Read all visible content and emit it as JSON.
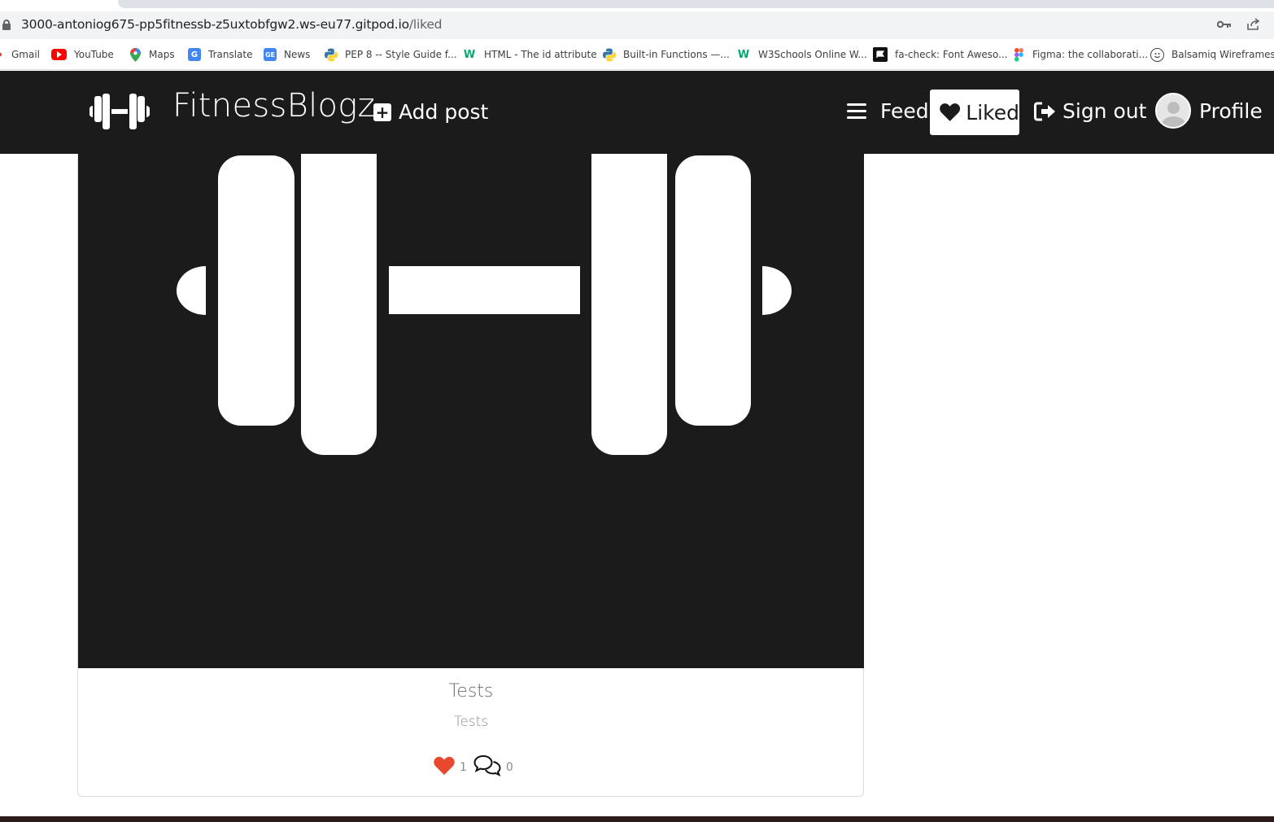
{
  "browser": {
    "url_host": "3000-antoniog675-pp5fitnessb-z5uxtobfgw2.ws-eu77.gitpod.io",
    "url_path": "/liked",
    "bookmarks": [
      {
        "label": "Gmail",
        "icon": "gmail-icon",
        "color": "#ea4335"
      },
      {
        "label": "YouTube",
        "icon": "youtube-icon",
        "color": "#ff0000"
      },
      {
        "label": "Maps",
        "icon": "maps-icon",
        "color": "#34a853"
      },
      {
        "label": "Translate",
        "icon": "translate-icon",
        "color": "#4285f4"
      },
      {
        "label": "News",
        "icon": "news-icon",
        "color": "#4285f4"
      },
      {
        "label": "PEP 8 -- Style Guide f...",
        "icon": "python-icon",
        "color": "#3776ab"
      },
      {
        "label": "HTML - The id attribute",
        "icon": "w3schools-icon",
        "color": "#04aa6d"
      },
      {
        "label": "Built-in Functions —...",
        "icon": "python-icon",
        "color": "#3776ab"
      },
      {
        "label": "W3Schools Online W...",
        "icon": "w3schools-icon",
        "color": "#04aa6d"
      },
      {
        "label": "fa-check: Font Aweso...",
        "icon": "fontawesome-icon",
        "color": "#111111"
      },
      {
        "label": "Figma: the collaborati...",
        "icon": "figma-icon",
        "color": "#f24e1e"
      },
      {
        "label": "Balsamiq Wireframes...",
        "icon": "balsamiq-icon",
        "color": "#444444"
      }
    ]
  },
  "nav": {
    "brand": "FitnessBlogz",
    "add_post": "Add post",
    "feed": "Feed",
    "liked": "Liked",
    "sign_out": "Sign out",
    "profile": "Profile"
  },
  "post": {
    "title": "Tests",
    "content": "Tests",
    "likes_count": "1",
    "comments_count": "0"
  },
  "colors": {
    "navbar": "#1b1b1b",
    "like_heart": "#e8492e",
    "text_muted": "#6b6b6b"
  }
}
